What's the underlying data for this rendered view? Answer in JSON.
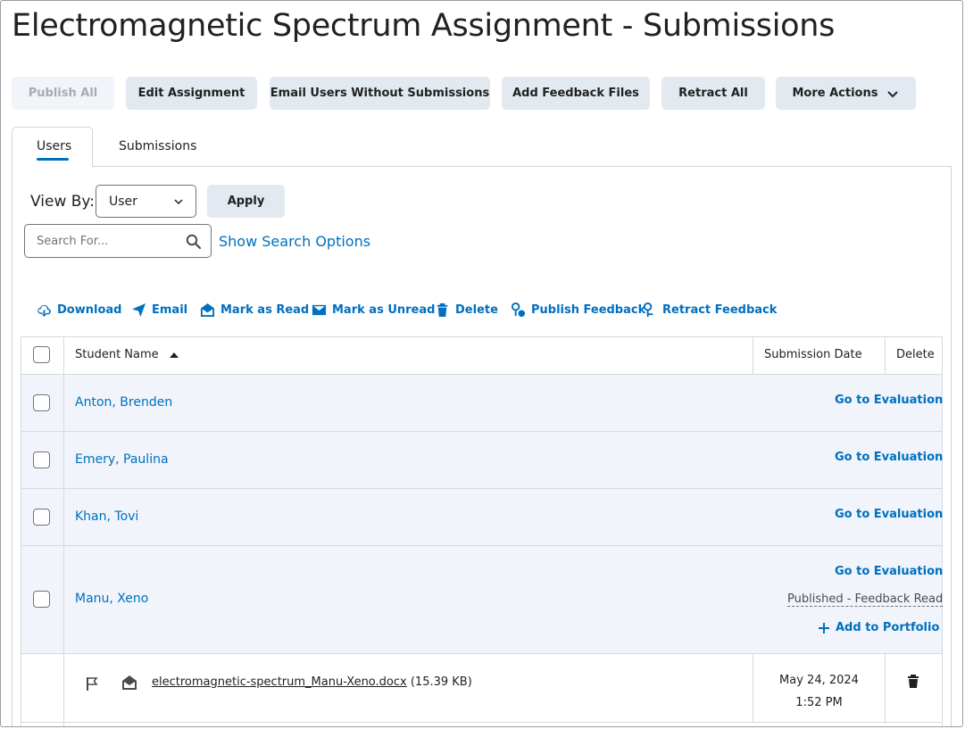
{
  "page": {
    "title": "Electromagnetic Spectrum Assignment - Submissions"
  },
  "toolbar": {
    "publish_all": "Publish All",
    "edit_assignment": "Edit Assignment",
    "email_users": "Email Users Without Submissions",
    "add_feedback_files": "Add Feedback Files",
    "retract_all": "Retract All",
    "more_actions": "More Actions"
  },
  "tabs": {
    "users": "Users",
    "submissions": "Submissions",
    "active": "Users"
  },
  "filter": {
    "view_by_label": "View By:",
    "view_by_value": "User",
    "apply": "Apply"
  },
  "search": {
    "placeholder": "Search For...",
    "show_options": "Show Search Options"
  },
  "actions": {
    "download": "Download",
    "email": "Email",
    "mark_read": "Mark as Read",
    "mark_unread": "Mark as Unread",
    "delete": "Delete",
    "publish_feedback": "Publish Feedback",
    "retract_feedback": "Retract Feedback"
  },
  "table": {
    "headers": {
      "student_name": "Student Name",
      "submission_date": "Submission Date",
      "delete": "Delete"
    },
    "go_to_evaluation": "Go to Evaluation",
    "rows": [
      {
        "name": "Anton, Brenden"
      },
      {
        "name": "Emery, Paulina"
      },
      {
        "name": "Khan, Tovi"
      },
      {
        "name": "Manu, Xeno",
        "status": "Published - Feedback Read",
        "add_portfolio": "Add to Portfolio"
      }
    ],
    "submission": {
      "file": "electromagnetic-spectrum_Manu-Xeno.docx",
      "size": "(15.39 KB)",
      "date": "May 24, 2024",
      "time": "1:52 PM"
    }
  },
  "colors": {
    "link": "#006fbf",
    "button_bg": "#e3e9f1",
    "row_bg": "#f1f5fb"
  }
}
